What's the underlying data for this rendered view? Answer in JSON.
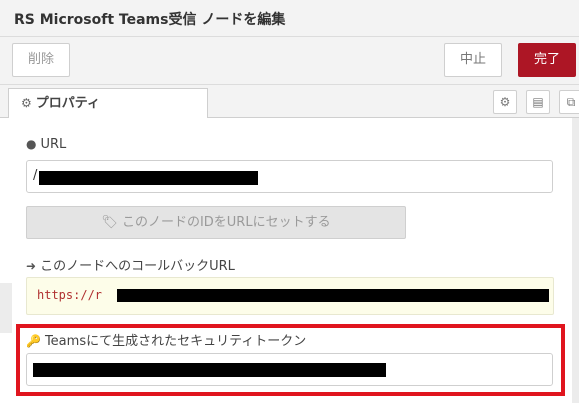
{
  "dialog": {
    "title": "RS Microsoft Teams受信 ノードを編集"
  },
  "toolbar": {
    "delete_label": "削除",
    "cancel_label": "中止",
    "done_label": "完了"
  },
  "tabs": {
    "properties_label": "プロパティ"
  },
  "fields": {
    "url_label": "URL",
    "url_value": "/",
    "set_id_button": "このノードのIDをURLにセットする",
    "callback_label": "このノードへのコールバックURL",
    "callback_value": "https://r",
    "token_label": "Teamsにて生成されたセキュリティトークン"
  },
  "icons": {
    "properties": "gear-icon",
    "url": "globe-icon",
    "set_id": "tag-icon",
    "callback": "sign-in-icon",
    "token": "key-icon"
  },
  "colors": {
    "accent": "#ad1625",
    "highlight": "#e0151e"
  }
}
